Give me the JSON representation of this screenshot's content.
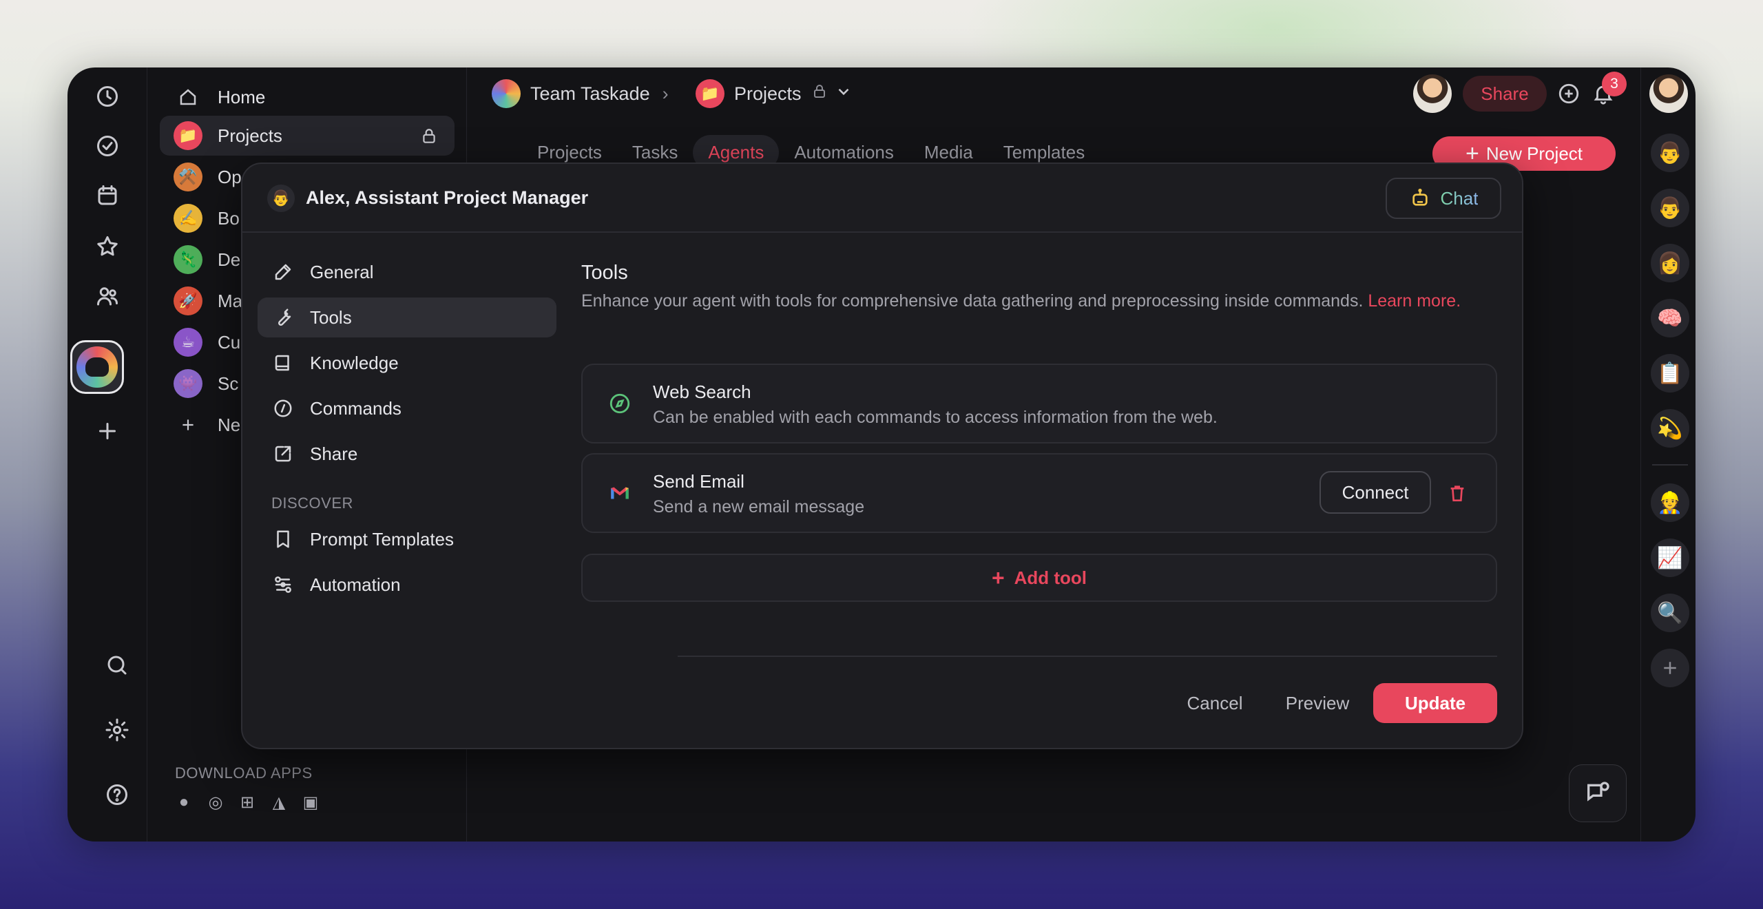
{
  "sidebar": {
    "items": [
      {
        "label": "Home",
        "icon": "home-icon"
      },
      {
        "label": "Projects",
        "icon": "folder-emoji",
        "emoji": "📁",
        "color": "#e8475d"
      },
      {
        "label": "Op",
        "emoji": "⚒️",
        "color": "#d77a3a"
      },
      {
        "label": "Bo",
        "emoji": "✍️",
        "color": "#e8b53a"
      },
      {
        "label": "De",
        "emoji": "🦎",
        "color": "#4fae5a"
      },
      {
        "label": "Ma",
        "emoji": "🚀",
        "color": "#d8503a"
      },
      {
        "label": "Cu",
        "emoji": "☕",
        "color": "#8a55c8"
      },
      {
        "label": "Sc",
        "emoji": "👾",
        "color": "#8a66c8"
      },
      {
        "label": "Ne",
        "icon": "plus-icon"
      }
    ],
    "download_title": "DOWNLOAD APPS",
    "download_icons": [
      "apple-icon",
      "chrome-icon",
      "windows-icon",
      "appstore-icon",
      "android-icon"
    ]
  },
  "header": {
    "workspace": "Team Taskade",
    "folder": "Projects",
    "share_label": "Share",
    "notifications": "3",
    "tabs": [
      "Projects",
      "Tasks",
      "Agents",
      "Automations",
      "Media",
      "Templates"
    ],
    "active_tab": "Agents",
    "new_project_label": "New Project"
  },
  "modal": {
    "title": "Alex, Assistant Project Manager",
    "agent_emoji": "👨",
    "chat_label": "Chat",
    "nav": [
      {
        "label": "General",
        "icon": "pencil-icon"
      },
      {
        "label": "Tools",
        "icon": "wrench-icon"
      },
      {
        "label": "Knowledge",
        "icon": "book-icon"
      },
      {
        "label": "Commands",
        "icon": "slash-icon"
      },
      {
        "label": "Share",
        "icon": "share-icon"
      }
    ],
    "discover_title": "DISCOVER",
    "discover": [
      {
        "label": "Prompt Templates",
        "icon": "bookmark-icon"
      },
      {
        "label": "Automation",
        "icon": "automation-icon"
      }
    ],
    "content": {
      "title": "Tools",
      "description": "Enhance your agent with tools for comprehensive data gathering and preprocessing inside commands.",
      "learn_more": "Learn more.",
      "tools": [
        {
          "name": "Web Search",
          "desc": "Can be enabled with each commands to access information from the web.",
          "icon": "compass-icon"
        },
        {
          "name": "Send Email",
          "desc": "Send a new email message",
          "icon": "gmail-icon",
          "connect_label": "Connect"
        }
      ],
      "add_tool_label": "Add tool"
    },
    "footer": {
      "cancel": "Cancel",
      "preview": "Preview",
      "update": "Update"
    }
  },
  "right_rail": {
    "agents": [
      "👨",
      "👨",
      "👩",
      "🧠",
      "📋",
      "💫",
      "👷",
      "📈",
      "🔍"
    ]
  },
  "colors": {
    "accent": "#e8475d",
    "surface": "#1c1c20",
    "bg": "#131316"
  }
}
